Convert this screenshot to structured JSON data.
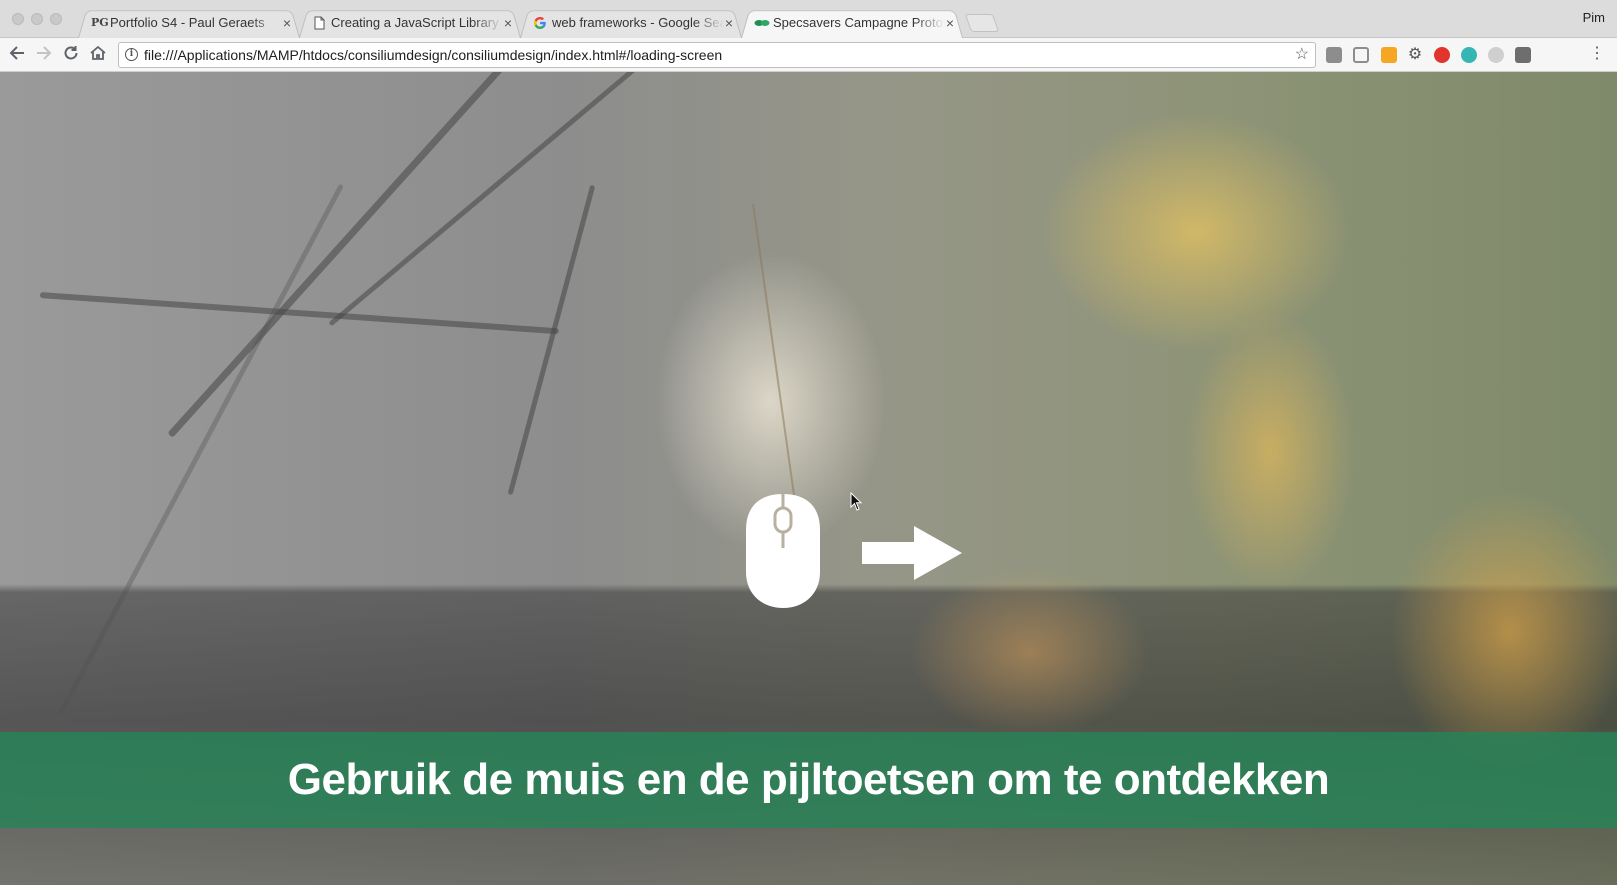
{
  "browser": {
    "tabs": [
      {
        "title": "Portfolio S4 - Paul Geraets",
        "favicon": "PG",
        "active": false
      },
      {
        "title": "Creating a JavaScript Library",
        "favicon": "page-icon",
        "active": false
      },
      {
        "title": "web frameworks - Google Sea",
        "favicon": "google-icon",
        "active": false
      },
      {
        "title": "Specsavers Campagne Prototy",
        "favicon": "specsavers-icon",
        "active": true
      }
    ],
    "close_glyph": "×",
    "profile_name": "Pim",
    "url": "file:///Applications/MAMP/htdocs/consiliumdesign/consiliumdesign/index.html#/loading-screen"
  },
  "page": {
    "instruction": "Gebruik de muis en de pijltoetsen om te ontdekken",
    "banner_color": "#2a8a5c",
    "icons": [
      "mouse-icon",
      "arrow-right-icon",
      "cursor-icon"
    ]
  }
}
